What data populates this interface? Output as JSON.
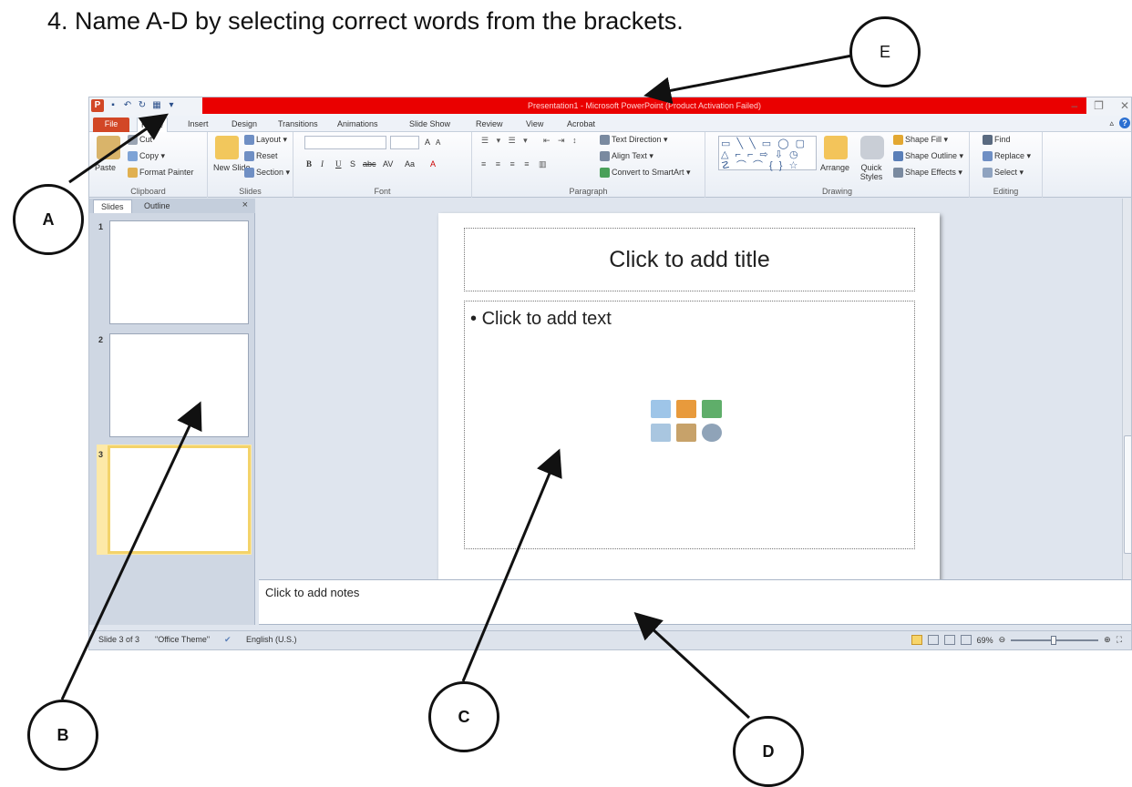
{
  "question": "4.  Name A-D by selecting correct words from the brackets.",
  "window": {
    "title": "Presentation1 - Microsoft PowerPoint (Product Activation Failed)",
    "logo": "P"
  },
  "tabs": [
    "File",
    "Home",
    "Insert",
    "Design",
    "Transitions",
    "Animations",
    "Slide Show",
    "Review",
    "View",
    "Acrobat"
  ],
  "ribbon": {
    "clipboard": {
      "label": "Clipboard",
      "paste": "Paste",
      "cut": "Cut",
      "copy": "Copy",
      "format_painter": "Format Painter"
    },
    "slides": {
      "label": "Slides",
      "new_slide": "New Slide",
      "layout": "Layout",
      "reset": "Reset",
      "section": "Section"
    },
    "font": {
      "label": "Font",
      "bold": "B",
      "italic": "I",
      "underline": "U",
      "strike": "S",
      "abc": "abc",
      "spacing": "AV",
      "case": "Aa",
      "grow": "A",
      "shrink": "A",
      "color": "A"
    },
    "paragraph": {
      "label": "Paragraph",
      "text_direction": "Text Direction",
      "align_text": "Align Text",
      "smartart": "Convert to SmartArt"
    },
    "drawing": {
      "label": "Drawing",
      "arrange": "Arrange",
      "quick_styles": "Quick Styles",
      "shape_fill": "Shape Fill",
      "shape_outline": "Shape Outline",
      "shape_effects": "Shape Effects"
    },
    "editing": {
      "label": "Editing",
      "find": "Find",
      "replace": "Replace",
      "select": "Select"
    }
  },
  "panel": {
    "tab_slides": "Slides",
    "tab_outline": "Outline",
    "close": "×",
    "thumbs": [
      "1",
      "2",
      "3"
    ],
    "selected": 3
  },
  "slide": {
    "title_placeholder": "Click to add title",
    "body_placeholder": "Click to add text",
    "bullet": "•"
  },
  "notes": {
    "placeholder": "Click to add notes"
  },
  "status": {
    "slide_info": "Slide 3 of 3",
    "theme": "\"Office Theme\"",
    "language": "English (U.S.)",
    "zoom": "69%"
  },
  "labels": {
    "A": "A",
    "B": "B",
    "C": "C",
    "D": "D",
    "E": "E"
  },
  "colors": {
    "title_bar": "#ea0000",
    "file_tab": "#d24726",
    "selected_thumb": "#f3d36a"
  }
}
